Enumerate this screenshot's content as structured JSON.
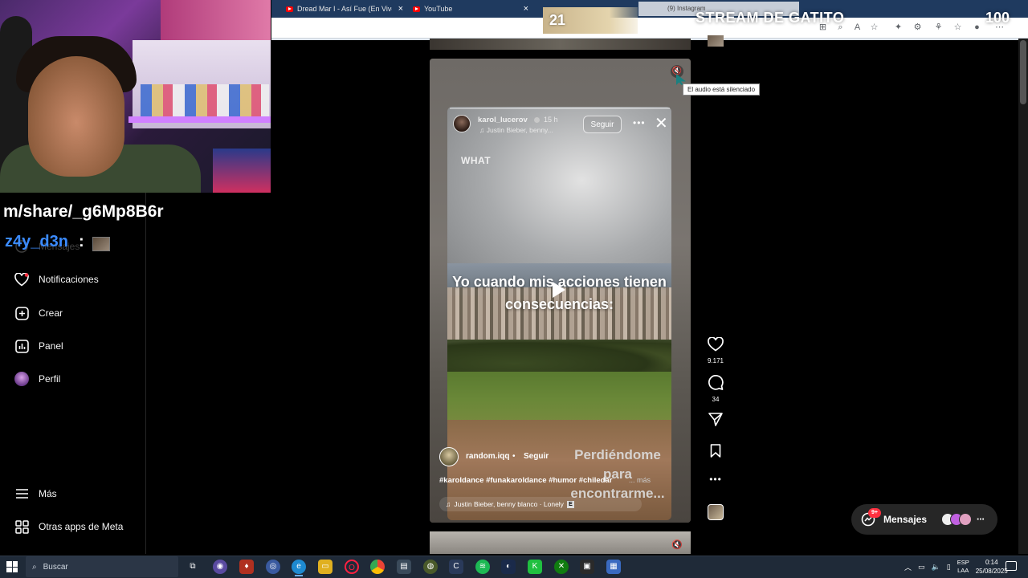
{
  "browser": {
    "tabs": [
      {
        "label": "Dread Mar I - Así Fue (En Vivo) - "
      },
      {
        "label": "YouTube"
      },
      {
        "label": "(9) Instagram"
      }
    ]
  },
  "stream": {
    "title": "STREAM DE GATITO",
    "counter_left": "21",
    "counter_right": "100"
  },
  "chat": {
    "url_fragment": "m/share/_g6Mp8B6r",
    "username": "z4y_d3n",
    "colon": ":"
  },
  "sidebar": {
    "partial_label": "Mensajes",
    "items": [
      {
        "label": "Notificaciones",
        "icon": "heart-icon"
      },
      {
        "label": "Crear",
        "icon": "plus-square-icon"
      },
      {
        "label": "Panel",
        "icon": "bar-chart-icon"
      },
      {
        "label": "Perfil",
        "icon": "profile-avatar"
      }
    ],
    "bottom": [
      {
        "label": "Más",
        "icon": "menu-icon"
      },
      {
        "label": "Otras apps de Meta",
        "icon": "apps-grid-icon"
      }
    ]
  },
  "story": {
    "username": "karol_lucerov",
    "time": "15 h",
    "music": "Justin Bieber, benny...",
    "follow": "Seguir",
    "sticker_text": "WHAT",
    "caption": "Yo cuando mis acciones tienen consecuencias:"
  },
  "reel": {
    "mute_tooltip": "El audio está silenciado",
    "author": "random.iqq",
    "dot": "•",
    "follow": "Seguir",
    "overlay_text": "Perdiéndome para encontrarme...",
    "hashtags": "#karoldance #funakaroldance #humor #chiledar",
    "more": "... más",
    "audio": "Justin Bieber, benny blanco · Lonely",
    "explicit": "E",
    "likes": "9.171",
    "comments": "34"
  },
  "messages": {
    "label": "Mensajes",
    "badge": "9+"
  },
  "taskbar": {
    "search_placeholder": "Buscar",
    "lang_top": "ESP",
    "lang_bottom": "LAA",
    "time": "0:14",
    "date": "25/08/2025"
  }
}
